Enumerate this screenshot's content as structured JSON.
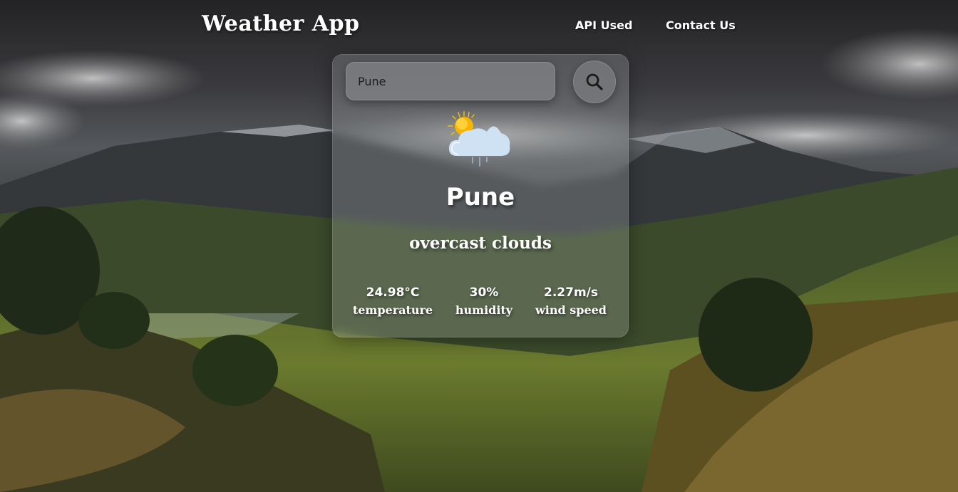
{
  "header": {
    "title": "Weather App",
    "nav": [
      "API Used",
      "Contact Us"
    ]
  },
  "search": {
    "value": "Pune",
    "placeholder": "",
    "icon": "search-icon"
  },
  "weather": {
    "icon": "partly-cloudy-rain-icon",
    "city": "Pune",
    "description": "overcast clouds",
    "stats": [
      {
        "value": "24.98°C",
        "label": "temperature"
      },
      {
        "value": "30%",
        "label": "humidity"
      },
      {
        "value": "2.27m/s",
        "label": "wind speed"
      }
    ]
  },
  "colors": {
    "text": "#ffffff",
    "card": "#d2d7d7",
    "sun": "#f5b800"
  }
}
